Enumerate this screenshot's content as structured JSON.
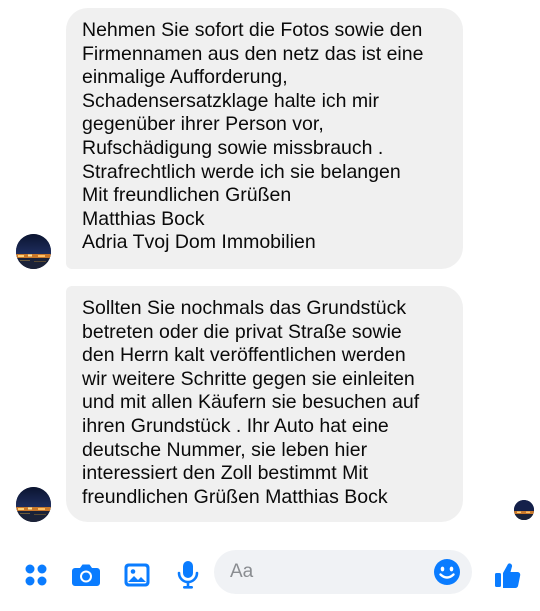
{
  "conversation": {
    "messages": [
      {
        "sender": "Matthias Bock",
        "text": "Nehmen Sie sofort die Fotos sowie den\nFirmennamen aus den netz das ist eine\neinmalige Aufforderung,\nSchadensersatzklage halte ich mir\ngegenüber ihrer Person vor,\nRufschädigung sowie missbrauch .\nStrafrechtlich werde ich sie belangen\nMit freundlichen Grüßen\nMatthias Bock\nAdria Tvoj Dom Immobilien"
      },
      {
        "sender": "Matthias Bock",
        "text": "Sollten Sie nochmals das Grundstück\nbetreten oder die privat Straße sowie\nden Herrn kalt veröffentlichen werden\nwir weitere Schritte gegen sie einleiten\nund mit allen Käufern sie besuchen auf\nihren Grundstück . Ihr Auto hat eine\ndeutsche Nummer, sie leben hier\ninteressiert den Zoll bestimmt Mit\nfreundlichen Grüßen Matthias Bock"
      }
    ]
  },
  "composer": {
    "placeholder": "Aa",
    "icons": [
      "apps-icon",
      "camera-icon",
      "gallery-icon",
      "microphone-icon",
      "emoji-icon",
      "thumbs-up-icon"
    ],
    "accent_color": "#0084ff"
  },
  "colors": {
    "bubble_bg": "#f0f0f0",
    "input_bg": "#f0f2f5",
    "accent": "#0a7cff"
  }
}
